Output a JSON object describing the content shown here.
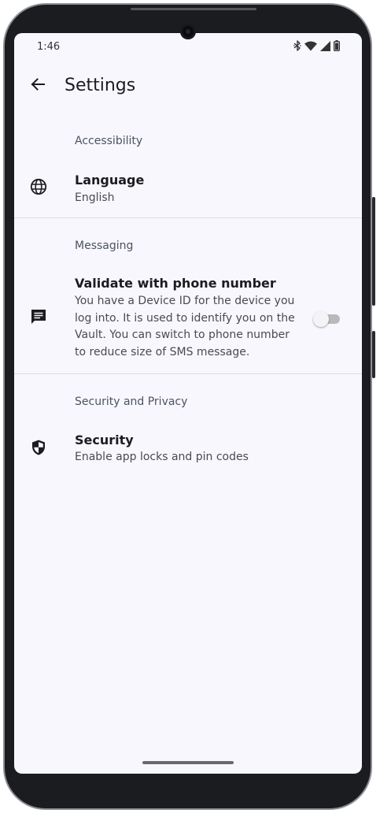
{
  "status_bar": {
    "time": "1:46",
    "icons": [
      "bluetooth-icon",
      "wifi-icon",
      "signal-icon",
      "battery-icon"
    ]
  },
  "app_bar": {
    "back_icon": "arrow-back-icon",
    "title": "Settings"
  },
  "sections": {
    "accessibility": {
      "header": "Accessibility",
      "language": {
        "icon": "globe-icon",
        "title": "Language",
        "summary": "English"
      }
    },
    "messaging": {
      "header": "Messaging",
      "validate": {
        "icon": "message-icon",
        "title": "Validate with phone number",
        "summary_lines": [
          "You have a Device ID for the device you",
          "log into. It is used to identify you on the",
          "Vault. You can switch to phone number",
          "to reduce size of SMS message."
        ],
        "switch_on": false
      }
    },
    "security_privacy": {
      "header": "Security and Privacy",
      "security": {
        "icon": "shield-icon",
        "title": "Security",
        "summary": "Enable app locks and pin codes"
      }
    }
  },
  "colors": {
    "background": "#f8f7fd",
    "text_primary": "#1c1b1f",
    "section_header": "#4a5461",
    "switch_track_off": "#b9b9bd"
  }
}
